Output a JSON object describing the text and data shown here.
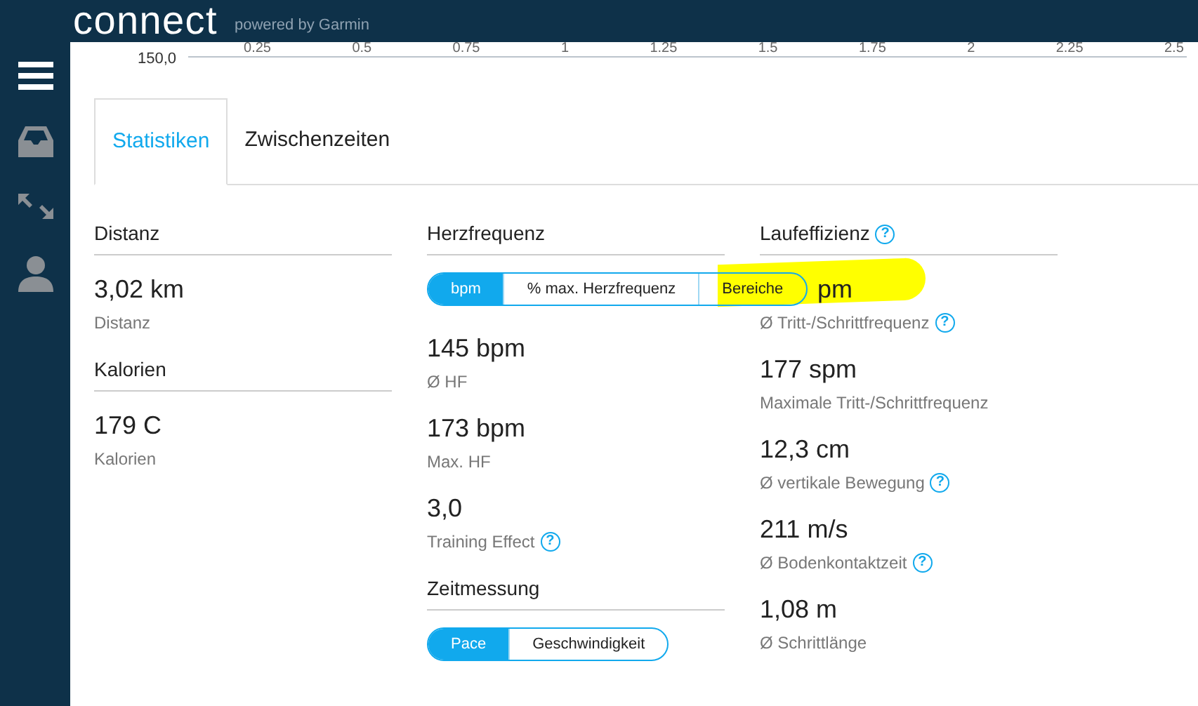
{
  "header": {
    "logo": "connect",
    "tagline": "powered by Garmin"
  },
  "axis": {
    "y_label": "150,0",
    "ticks": [
      "0.25",
      "0.5",
      "0.75",
      "1",
      "1.25",
      "1.5",
      "1.75",
      "2",
      "2.25",
      "2.5"
    ]
  },
  "tabs": [
    {
      "label": "Statistiken",
      "selected": true
    },
    {
      "label": "Zwischenzeiten",
      "selected": false
    }
  ],
  "columns": [
    {
      "sections": [
        {
          "title": "Distanz",
          "stats": [
            {
              "value": "3,02 km",
              "label": "Distanz"
            }
          ]
        },
        {
          "title": "Kalorien",
          "stats": [
            {
              "value": "179 C",
              "label": "Kalorien"
            }
          ]
        }
      ]
    },
    {
      "sections": [
        {
          "title": "Herzfrequenz",
          "toggle": [
            {
              "label": "bpm",
              "selected": true
            },
            {
              "label": "% max. Herzfrequenz",
              "selected": false
            },
            {
              "label": "Bereiche",
              "selected": false
            }
          ],
          "stats": [
            {
              "value": "145 bpm",
              "label": "Ø HF"
            },
            {
              "value": "173 bpm",
              "label": "Max. HF"
            },
            {
              "value": "3,0",
              "label": "Training Effect",
              "help": "?"
            }
          ]
        },
        {
          "title": "Zeitmessung",
          "toggle": [
            {
              "label": "Pace",
              "selected": true
            },
            {
              "label": "Geschwindigkeit",
              "selected": false
            }
          ]
        }
      ]
    },
    {
      "sections": [
        {
          "title": "Laufeffizienz",
          "help": "?",
          "stats": [
            {
              "value": "pm",
              "label": "Ø Tritt-/Schrittfrequenz",
              "help": "?",
              "highlighted": true
            },
            {
              "value": "177 spm",
              "label": "Maximale Tritt-/Schrittfrequenz"
            },
            {
              "value": "12,3 cm",
              "label": "Ø vertikale Bewegung",
              "help": "?"
            },
            {
              "value": "211 m/s",
              "label": "Ø Bodenkontaktzeit",
              "help": "?"
            },
            {
              "value": "1,08 m",
              "label": "Ø Schrittlänge"
            }
          ]
        }
      ]
    }
  ]
}
